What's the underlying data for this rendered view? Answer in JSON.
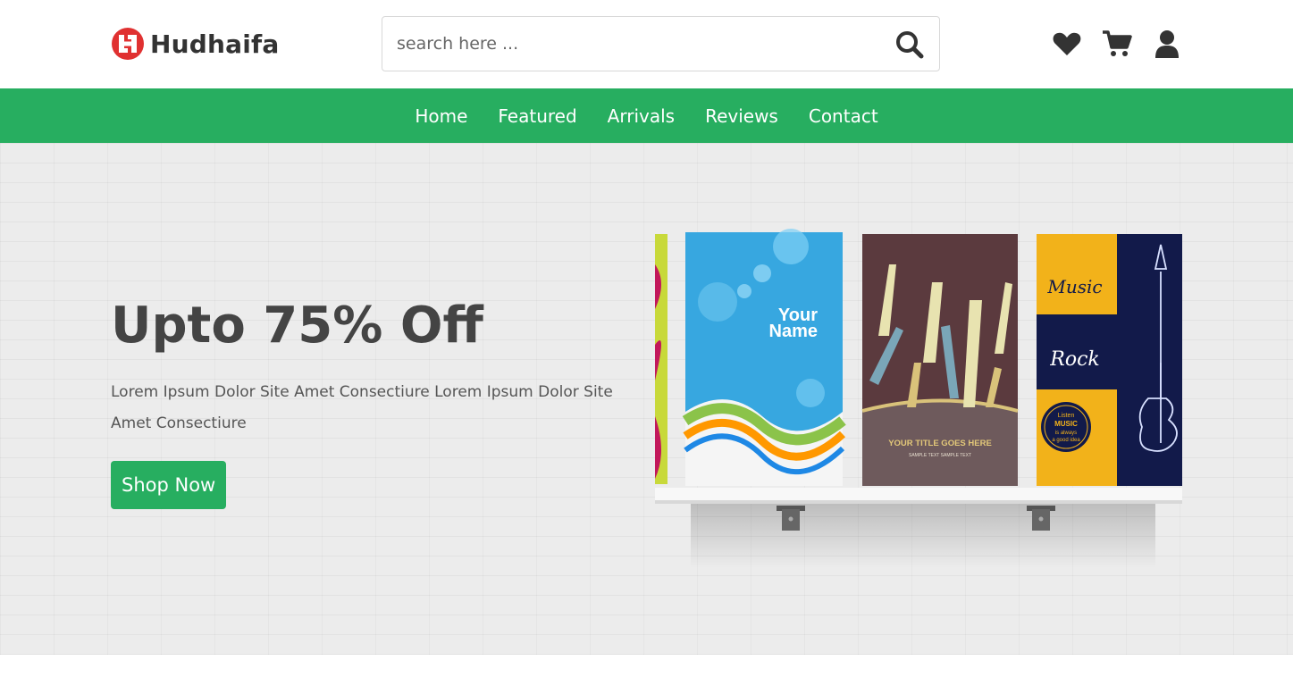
{
  "header": {
    "logo_text": "Hudhaifa",
    "search_placeholder": "search here ...",
    "icons": [
      "heart-icon",
      "cart-icon",
      "user-icon"
    ]
  },
  "nav": {
    "items": [
      "Home",
      "Featured",
      "Arrivals",
      "Reviews",
      "Contact"
    ]
  },
  "hero": {
    "title": "Upto 75% Off",
    "text": "Lorem Ipsum Dolor Site Amet Consectiure Lorem Ipsum Dolor Site Amet Consectiure",
    "button": "Shop Now",
    "book_covers": {
      "book1_title": "Your Name",
      "book2_title": "YOUR TITLE GOES HERE",
      "book2_subtitle": "SAMPLE TEXT SAMPLE TEXT",
      "book3_words": [
        "Music",
        "Rock",
        "Listen",
        "MUSIC",
        "is always",
        "a good idea"
      ]
    }
  },
  "colors": {
    "brand": "#27ae60",
    "logo": "#e03131",
    "text": "#333333"
  }
}
